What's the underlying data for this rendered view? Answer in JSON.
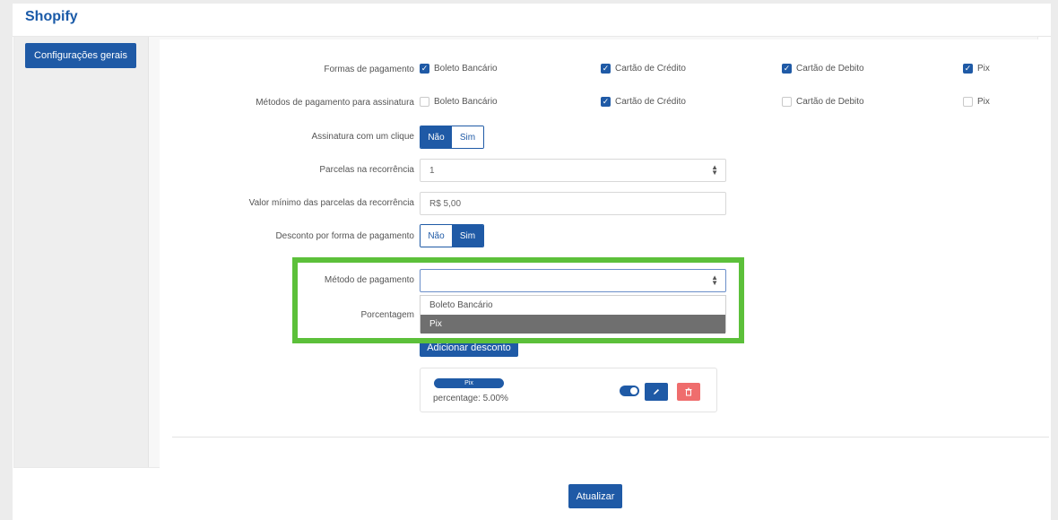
{
  "app": {
    "title": "Shopify"
  },
  "sidebar": {
    "button_label": "Configurações gerais"
  },
  "form": {
    "payment_forms": {
      "label": "Formas de pagamento",
      "options": [
        {
          "label": "Boleto Bancário",
          "checked": true
        },
        {
          "label": "Cartão de Crédito",
          "checked": true
        },
        {
          "label": "Cartão de Debito",
          "checked": true
        },
        {
          "label": "Pix",
          "checked": true
        }
      ]
    },
    "subscription_methods": {
      "label": "Métodos de pagamento para assinatura",
      "options": [
        {
          "label": "Boleto Bancário",
          "checked": false
        },
        {
          "label": "Cartão de Crédito",
          "checked": true
        },
        {
          "label": "Cartão de Debito",
          "checked": false
        },
        {
          "label": "Pix",
          "checked": false
        }
      ]
    },
    "one_click": {
      "label": "Assinatura com um clique",
      "no": "Não",
      "yes": "Sim",
      "selected": "no"
    },
    "installments": {
      "label": "Parcelas na recorrência",
      "value": "1"
    },
    "min_installment": {
      "label": "Valor mínimo das parcelas da recorrência",
      "value": "R$ 5,00"
    },
    "discount_by_method": {
      "label": "Desconto por forma de pagamento",
      "no": "Não",
      "yes": "Sim",
      "selected": "yes"
    },
    "payment_method": {
      "label": "Método de pagamento",
      "value": "",
      "options": [
        {
          "label": "Boleto Bancário",
          "highlighted": false
        },
        {
          "label": "Pix",
          "highlighted": true
        }
      ]
    },
    "percentage": {
      "label": "Porcentagem"
    },
    "add_discount_label": "Adicionar desconto"
  },
  "discount_card": {
    "method": "Pix",
    "text": "percentage: 5.00%",
    "enabled": true
  },
  "footer": {
    "update_label": "Atualizar"
  },
  "colors": {
    "primary": "#1f5aa6",
    "danger": "#ef6d6d",
    "highlight_box": "#5cc03a"
  }
}
